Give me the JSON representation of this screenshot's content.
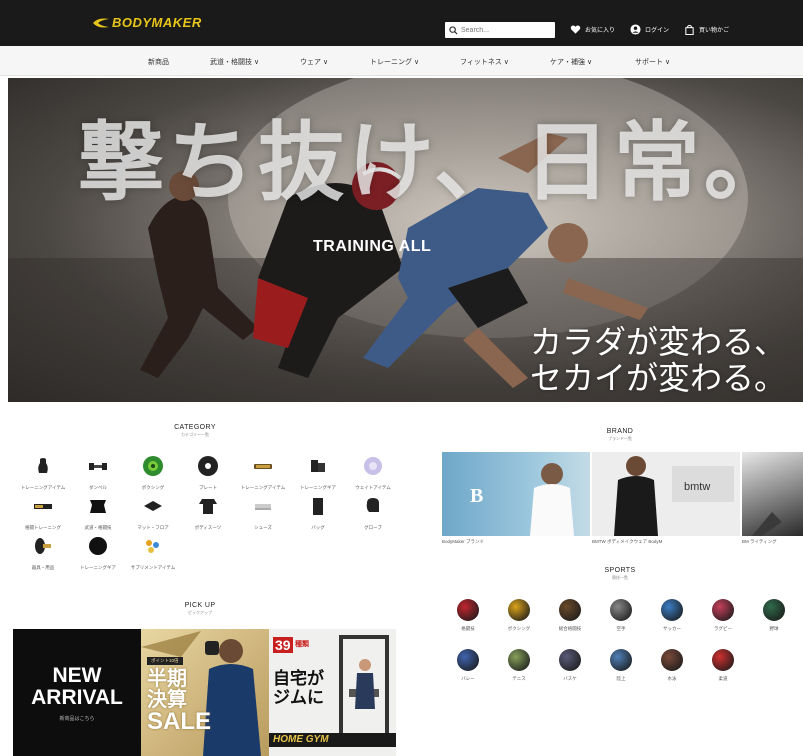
{
  "header": {
    "logo_text": "BODYMAKER",
    "search_placeholder": "Search...",
    "links": [
      {
        "label": "お気に入り",
        "icon": "heart-icon"
      },
      {
        "label": "ログイン",
        "icon": "user-icon"
      },
      {
        "label": "買い物かご",
        "icon": "bag-icon"
      }
    ]
  },
  "nav": {
    "items": [
      "新商品",
      "武道・格闘技 ∨",
      "ウェア ∨",
      "トレーニング ∨",
      "フィットネス ∨",
      "ケア・補強 ∨",
      "サポート ∨"
    ]
  },
  "hero": {
    "title": "撃ち抜け、日常。",
    "center_text": "TRAINING ALL",
    "subtitle_line1": "カラダが変わる、",
    "subtitle_line2": "セカイが変わる。"
  },
  "category": {
    "title": "CATEGORY",
    "subtitle": "カテゴリー一覧",
    "items": [
      {
        "label": "トレーニングアイテム",
        "icon": "kettlebell-icon"
      },
      {
        "label": "ダンベル",
        "icon": "dumbbell-icon"
      },
      {
        "label": "ボクシング",
        "icon": "boxing-target-icon"
      },
      {
        "label": "プレート",
        "icon": "weight-plate-icon"
      },
      {
        "label": "トレーニングアイテム",
        "icon": "grip-icon"
      },
      {
        "label": "トレーニングギア",
        "icon": "gear-bag-icon"
      },
      {
        "label": "ウェイトアイテム",
        "icon": "ball-icon"
      },
      {
        "label": "格闘トレーニング",
        "icon": "pad-icon"
      },
      {
        "label": "武道・格闘技",
        "icon": "gi-icon"
      },
      {
        "label": "マット・フロア",
        "icon": "mat-icon"
      },
      {
        "label": "ボディスーツ",
        "icon": "shirt-icon"
      },
      {
        "label": "シューズ",
        "icon": "shoes-icon"
      },
      {
        "label": "バッグ",
        "icon": "bag-item-icon"
      },
      {
        "label": "グローブ",
        "icon": "glove-icon"
      },
      {
        "label": "器具・用品",
        "icon": "roller-icon"
      },
      {
        "label": "トレーニングギア",
        "icon": "medicine-ball-icon"
      },
      {
        "label": "サプリメントアイテム",
        "icon": "supplement-icon"
      }
    ]
  },
  "pickup": {
    "title": "PICK UP",
    "subtitle": "ピックアップ",
    "new_arrival": {
      "line1": "NEW",
      "line2": "ARRIVAL",
      "caption": "新商品はこちら"
    },
    "sale": {
      "badge": "ポイント10倍",
      "line1": "半期",
      "line2": "決算",
      "line3": "SALE"
    },
    "gym": {
      "badge_num": "39",
      "badge_text": "種類",
      "line1": "自宅が",
      "line2": "ジムに",
      "banner": "HOME GYM"
    }
  },
  "brand": {
    "title": "BRAND",
    "subtitle": "ブランド一覧",
    "items": [
      {
        "caption": "BodyMaker ブランド",
        "logo": "B"
      },
      {
        "caption": "BMTW ボディメイクウェア BodyM",
        "logo": "bmtw"
      },
      {
        "caption": "BM ライティング"
      }
    ]
  },
  "sports": {
    "title": "SPORTS",
    "subtitle": "競技一覧",
    "items": [
      {
        "label": "格闘技",
        "color": "#c0262e"
      },
      {
        "label": "ボクシング",
        "color": "#d9a21a"
      },
      {
        "label": "総合格闘技",
        "color": "#6a4a2a"
      },
      {
        "label": "空手",
        "color": "#888"
      },
      {
        "label": "サッカー",
        "color": "#3b7dc4"
      },
      {
        "label": "ラグビー",
        "color": "#c4405a"
      },
      {
        "label": "野球",
        "color": "#2f6a4a"
      },
      {
        "label": "バレー",
        "color": "#4064b0"
      },
      {
        "label": "テニス",
        "color": "#86a05a"
      },
      {
        "label": "バスケ",
        "color": "#5a5a7a"
      },
      {
        "label": "陸上",
        "color": "#5080b8"
      },
      {
        "label": "水泳",
        "color": "#7a4a3a"
      },
      {
        "label": "柔道",
        "color": "#d03030"
      }
    ]
  }
}
